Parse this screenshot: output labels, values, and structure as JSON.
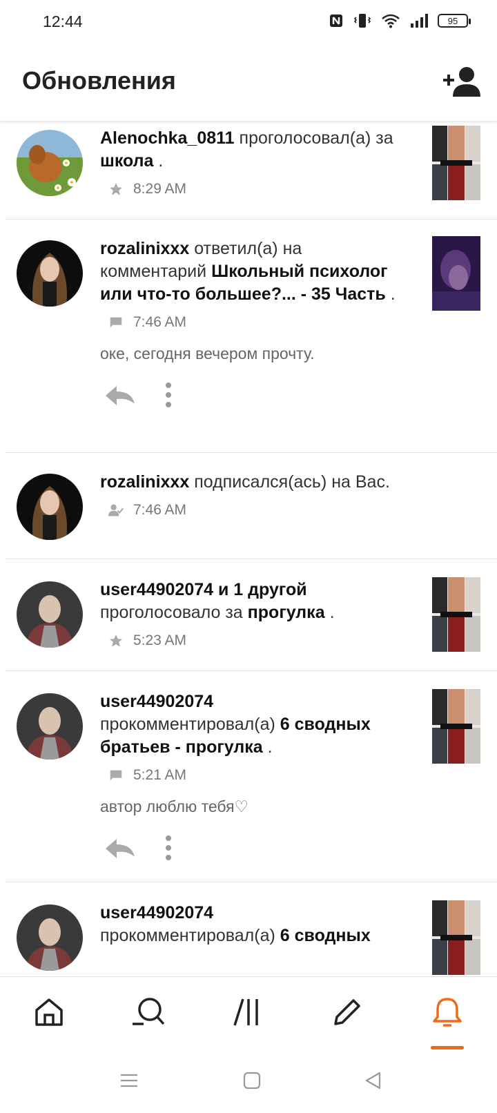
{
  "status": {
    "time": "12:44",
    "battery": "95"
  },
  "header": {
    "title": "Обновления",
    "add_friend_icon": "add-person-icon"
  },
  "notifications": [
    {
      "user": "Alenochka_0811",
      "action": "проголосовал(а) за",
      "target": "школа",
      "suffix": ".",
      "icon": "star-icon",
      "time": "8:29 AM"
    },
    {
      "user": "rozalinixxx",
      "action": "ответил(а) на комментарий",
      "target": "Школьный психолог или что-то большее?... - 35 Часть",
      "suffix": ".",
      "icon": "comment-icon",
      "time": "7:46 AM",
      "comment": "оке, сегодня вечером прочту."
    },
    {
      "user": "rozalinixxx",
      "action": "подписался(ась) на Вас.",
      "icon": "follower-icon",
      "time": "7:46 AM"
    },
    {
      "user": "user44902074 и 1 другой",
      "action": "проголосовало за",
      "target": "прогулка",
      "suffix": ".",
      "icon": "star-icon",
      "time": "5:23 AM"
    },
    {
      "user": "user44902074",
      "action": "прокомментировал(а)",
      "target": "6 сводных братьев - прогулка",
      "suffix": ".",
      "icon": "comment-icon",
      "time": "5:21 AM",
      "comment": "автор люблю тебя♡"
    },
    {
      "user": "user44902074",
      "action": "прокомментировал(а)",
      "target": "6 сводных"
    }
  ],
  "nav": {
    "items": [
      "home-icon",
      "search-icon",
      "library-icon",
      "write-icon",
      "notifications-bell-icon"
    ],
    "active": "notifications-bell-icon",
    "accent_color": "#ee6b1a"
  },
  "system_nav": [
    "menu-icon",
    "home-square-icon",
    "back-triangle-icon"
  ]
}
